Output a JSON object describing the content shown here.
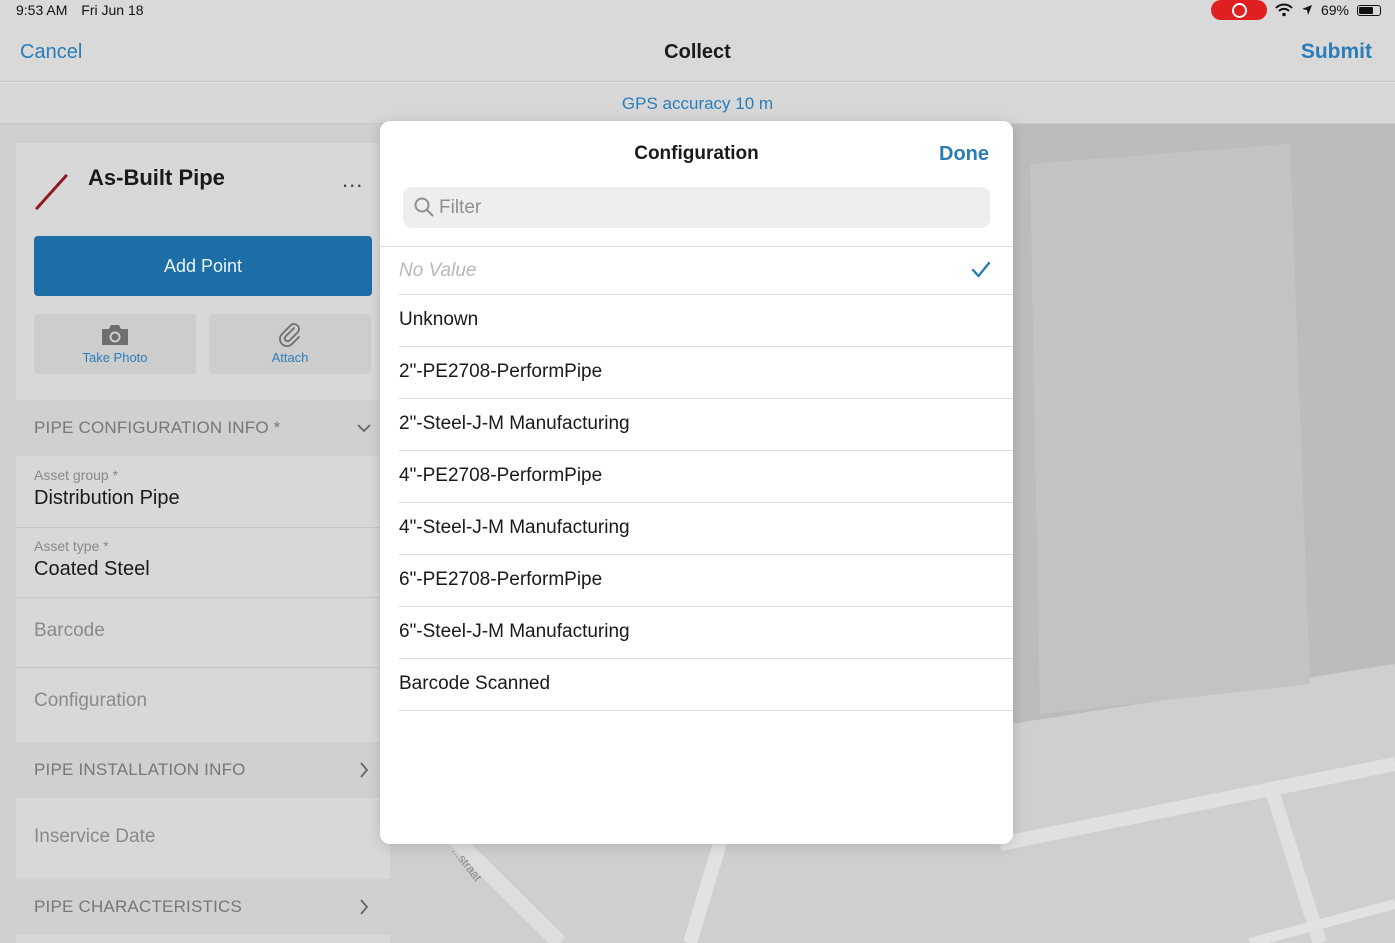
{
  "status_bar": {
    "time": "9:53 AM",
    "date": "Fri Jun 18",
    "battery_percent": "69%",
    "battery_level": 0.69
  },
  "nav": {
    "cancel_label": "Cancel",
    "title": "Collect",
    "submit_label": "Submit"
  },
  "gps": {
    "text": "GPS accuracy 10 m"
  },
  "feature": {
    "title": "As-Built Pipe",
    "more_label": "...",
    "add_point_label": "Add Point",
    "take_photo_label": "Take Photo",
    "attach_label": "Attach"
  },
  "form": {
    "section_config": "PIPE CONFIGURATION INFO *",
    "asset_group_label": "Asset group *",
    "asset_group_value": "Distribution Pipe",
    "asset_type_label": "Asset type *",
    "asset_type_value": "Coated Steel",
    "barcode_label": "Barcode",
    "configuration_label": "Configuration",
    "section_installation": "PIPE INSTALLATION INFO",
    "inservice_date_label": "Inservice Date",
    "section_characteristics": "PIPE CHARACTERISTICS"
  },
  "map": {
    "street_label": "...straat"
  },
  "popover": {
    "title": "Configuration",
    "done_label": "Done",
    "filter_placeholder": "Filter",
    "no_value_label": "No Value",
    "options": [
      "Unknown",
      "2\"-PE2708-PerformPipe",
      "2\"-Steel-J-M Manufacturing",
      "4\"-PE2708-PerformPipe",
      "4\"-Steel-J-M Manufacturing",
      "6\"-PE2708-PerformPipe",
      "6\"-Steel-J-M Manufacturing",
      "Barcode Scanned"
    ]
  },
  "colors": {
    "accent": "#2a7db8",
    "add_point_bg": "#1d6da6",
    "pipe_symbol": "#8e1a26",
    "record_indicator": "#e02020"
  }
}
